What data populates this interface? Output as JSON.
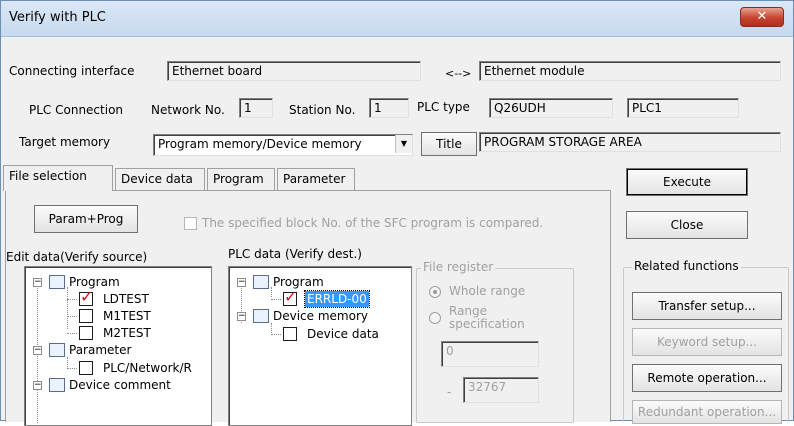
{
  "window": {
    "title": "Verify with PLC",
    "close_glyph": "✕"
  },
  "connection": {
    "interface_label": "Connecting interface",
    "interface_value": "Ethernet board",
    "arrow": "<-->",
    "module_value": "Ethernet module",
    "plc_connection_label": "PLC Connection",
    "network_label": "Network No.",
    "network_value": "1",
    "station_label": "Station No.",
    "station_value": "1",
    "plc_type_label": "PLC type",
    "plc_type_value": "Q26UDH",
    "plc_name_value": "PLC1",
    "target_memory_label": "Target memory",
    "target_memory_value": "Program memory/Device memory",
    "title_button": "Title",
    "title_value": "PROGRAM STORAGE AREA"
  },
  "tabs": [
    "File selection",
    "Device data",
    "Program",
    "Parameter"
  ],
  "file_selection": {
    "param_prog_button": "Param+Prog",
    "sfc_checkbox_label": "The specified block No. of the SFC program is compared.",
    "edit_data_label": "Edit data(Verify source)",
    "plc_data_label": "PLC data (Verify dest.)",
    "edit_tree": {
      "program": "Program",
      "items": [
        "LDTEST",
        "M1TEST",
        "M2TEST"
      ],
      "parameter": "Parameter",
      "parameter_item": "PLC/Network/R",
      "device_comment": "Device comment"
    },
    "plc_tree": {
      "program": "Program",
      "program_item": "ERRLD-00",
      "device_memory": "Device memory",
      "device_item": "Device data"
    },
    "file_register": {
      "label": "File register",
      "whole_range": "Whole range",
      "range_spec_1": "Range",
      "range_spec_2": "specification",
      "start_value": "0",
      "dash": "-",
      "end_value": "32767"
    }
  },
  "side": {
    "execute": "Execute",
    "close": "Close",
    "related_label": "Related functions",
    "transfer_setup": "Transfer setup...",
    "keyword_setup": "Keyword setup...",
    "remote_operation": "Remote operation...",
    "redundant_operation": "Redundant operation..."
  },
  "icons": {
    "expander_minus": "−",
    "check_mark": "✓",
    "dropdown": "▼"
  }
}
